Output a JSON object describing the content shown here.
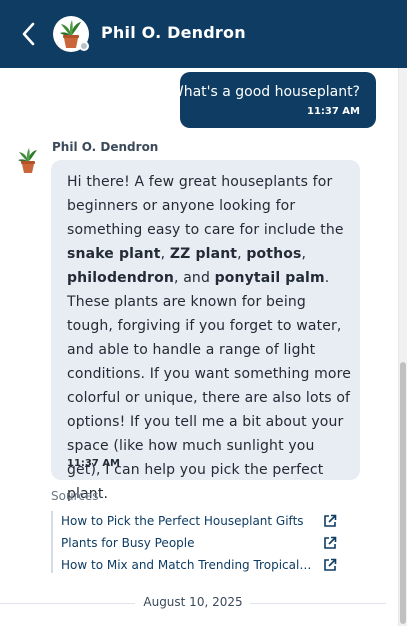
{
  "header": {
    "title": "Phil O. Dendron",
    "back_icon": "chevron-left-icon",
    "avatar_icon": "potted-plant-icon",
    "background": "#0e3c63"
  },
  "messages": {
    "user": {
      "text": "What's a good houseplant?",
      "time": "11:37 AM"
    },
    "bot": {
      "name": "Phil O. Dendron",
      "time": "11:37 AM",
      "parts": {
        "p1": "Hi there! A few great houseplants for beginners or anyone looking for something easy to care for include the ",
        "b1": "snake plant",
        "p2": ", ",
        "b2": "ZZ plant",
        "p3": ", ",
        "b3": "pothos",
        "p4": ", ",
        "b4": "philodendron",
        "p5": ", and ",
        "b5": "ponytail palm",
        "p6": ". These plants are known for being tough, forgiving if you forget to water, and able to handle a range of light conditions. If you want something more colorful or unique, there are also lots of options! If you tell me a bit about your space (like how much sunlight you get), I can help you pick the perfect plant."
      }
    }
  },
  "sources": {
    "label": "Sources",
    "items": [
      {
        "label": "How to Pick the Perfect Houseplant Gifts"
      },
      {
        "label": "Plants for Busy People"
      },
      {
        "label": "How to Mix and Match Trending Tropicals® Houseplants"
      }
    ]
  },
  "date_separator": "August 10, 2025"
}
